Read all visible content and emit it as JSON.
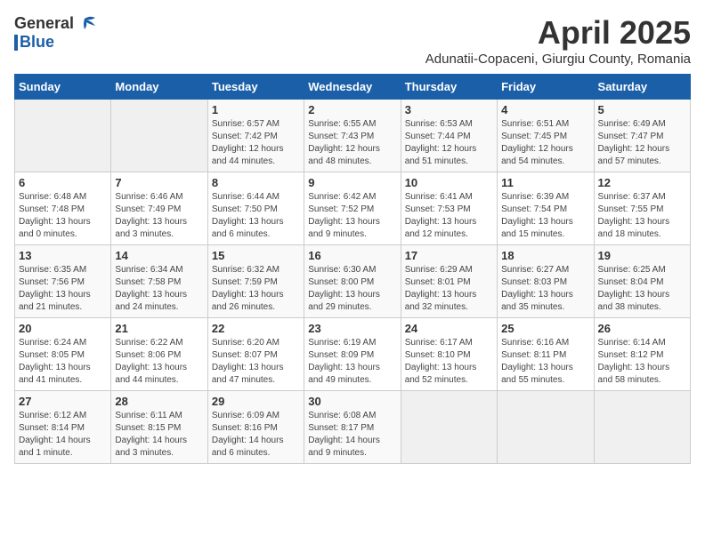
{
  "logo": {
    "general": "General",
    "blue": "Blue"
  },
  "title": {
    "month": "April 2025",
    "location": "Adunatii-Copaceni, Giurgiu County, Romania"
  },
  "calendar": {
    "headers": [
      "Sunday",
      "Monday",
      "Tuesday",
      "Wednesday",
      "Thursday",
      "Friday",
      "Saturday"
    ],
    "weeks": [
      [
        {
          "day": "",
          "detail": ""
        },
        {
          "day": "",
          "detail": ""
        },
        {
          "day": "1",
          "detail": "Sunrise: 6:57 AM\nSunset: 7:42 PM\nDaylight: 12 hours and 44 minutes."
        },
        {
          "day": "2",
          "detail": "Sunrise: 6:55 AM\nSunset: 7:43 PM\nDaylight: 12 hours and 48 minutes."
        },
        {
          "day": "3",
          "detail": "Sunrise: 6:53 AM\nSunset: 7:44 PM\nDaylight: 12 hours and 51 minutes."
        },
        {
          "day": "4",
          "detail": "Sunrise: 6:51 AM\nSunset: 7:45 PM\nDaylight: 12 hours and 54 minutes."
        },
        {
          "day": "5",
          "detail": "Sunrise: 6:49 AM\nSunset: 7:47 PM\nDaylight: 12 hours and 57 minutes."
        }
      ],
      [
        {
          "day": "6",
          "detail": "Sunrise: 6:48 AM\nSunset: 7:48 PM\nDaylight: 13 hours and 0 minutes."
        },
        {
          "day": "7",
          "detail": "Sunrise: 6:46 AM\nSunset: 7:49 PM\nDaylight: 13 hours and 3 minutes."
        },
        {
          "day": "8",
          "detail": "Sunrise: 6:44 AM\nSunset: 7:50 PM\nDaylight: 13 hours and 6 minutes."
        },
        {
          "day": "9",
          "detail": "Sunrise: 6:42 AM\nSunset: 7:52 PM\nDaylight: 13 hours and 9 minutes."
        },
        {
          "day": "10",
          "detail": "Sunrise: 6:41 AM\nSunset: 7:53 PM\nDaylight: 13 hours and 12 minutes."
        },
        {
          "day": "11",
          "detail": "Sunrise: 6:39 AM\nSunset: 7:54 PM\nDaylight: 13 hours and 15 minutes."
        },
        {
          "day": "12",
          "detail": "Sunrise: 6:37 AM\nSunset: 7:55 PM\nDaylight: 13 hours and 18 minutes."
        }
      ],
      [
        {
          "day": "13",
          "detail": "Sunrise: 6:35 AM\nSunset: 7:56 PM\nDaylight: 13 hours and 21 minutes."
        },
        {
          "day": "14",
          "detail": "Sunrise: 6:34 AM\nSunset: 7:58 PM\nDaylight: 13 hours and 24 minutes."
        },
        {
          "day": "15",
          "detail": "Sunrise: 6:32 AM\nSunset: 7:59 PM\nDaylight: 13 hours and 26 minutes."
        },
        {
          "day": "16",
          "detail": "Sunrise: 6:30 AM\nSunset: 8:00 PM\nDaylight: 13 hours and 29 minutes."
        },
        {
          "day": "17",
          "detail": "Sunrise: 6:29 AM\nSunset: 8:01 PM\nDaylight: 13 hours and 32 minutes."
        },
        {
          "day": "18",
          "detail": "Sunrise: 6:27 AM\nSunset: 8:03 PM\nDaylight: 13 hours and 35 minutes."
        },
        {
          "day": "19",
          "detail": "Sunrise: 6:25 AM\nSunset: 8:04 PM\nDaylight: 13 hours and 38 minutes."
        }
      ],
      [
        {
          "day": "20",
          "detail": "Sunrise: 6:24 AM\nSunset: 8:05 PM\nDaylight: 13 hours and 41 minutes."
        },
        {
          "day": "21",
          "detail": "Sunrise: 6:22 AM\nSunset: 8:06 PM\nDaylight: 13 hours and 44 minutes."
        },
        {
          "day": "22",
          "detail": "Sunrise: 6:20 AM\nSunset: 8:07 PM\nDaylight: 13 hours and 47 minutes."
        },
        {
          "day": "23",
          "detail": "Sunrise: 6:19 AM\nSunset: 8:09 PM\nDaylight: 13 hours and 49 minutes."
        },
        {
          "day": "24",
          "detail": "Sunrise: 6:17 AM\nSunset: 8:10 PM\nDaylight: 13 hours and 52 minutes."
        },
        {
          "day": "25",
          "detail": "Sunrise: 6:16 AM\nSunset: 8:11 PM\nDaylight: 13 hours and 55 minutes."
        },
        {
          "day": "26",
          "detail": "Sunrise: 6:14 AM\nSunset: 8:12 PM\nDaylight: 13 hours and 58 minutes."
        }
      ],
      [
        {
          "day": "27",
          "detail": "Sunrise: 6:12 AM\nSunset: 8:14 PM\nDaylight: 14 hours and 1 minute."
        },
        {
          "day": "28",
          "detail": "Sunrise: 6:11 AM\nSunset: 8:15 PM\nDaylight: 14 hours and 3 minutes."
        },
        {
          "day": "29",
          "detail": "Sunrise: 6:09 AM\nSunset: 8:16 PM\nDaylight: 14 hours and 6 minutes."
        },
        {
          "day": "30",
          "detail": "Sunrise: 6:08 AM\nSunset: 8:17 PM\nDaylight: 14 hours and 9 minutes."
        },
        {
          "day": "",
          "detail": ""
        },
        {
          "day": "",
          "detail": ""
        },
        {
          "day": "",
          "detail": ""
        }
      ]
    ]
  }
}
